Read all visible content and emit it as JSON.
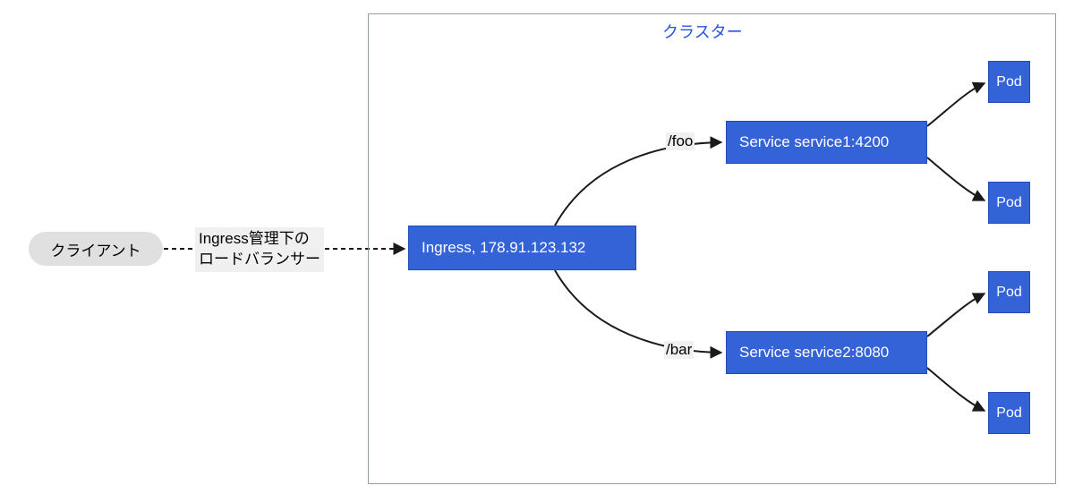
{
  "client_label": "クライアント",
  "lb_label_line1": "Ingress管理下の",
  "lb_label_line2": "ロードバランサー",
  "cluster_title": "クラスター",
  "ingress_label": "Ingress, 178.91.123.132",
  "service1_label": "Service service1:4200",
  "service2_label": "Service service2:8080",
  "route_foo": "/foo",
  "route_bar": "/bar",
  "pod_label": "Pod",
  "colors": {
    "node_bg": "#3463d8",
    "cluster_title": "#2454e6",
    "client_bg": "#e0e0e0"
  },
  "chart_data": {
    "type": "diagram",
    "title": "クラスター",
    "nodes": [
      {
        "id": "client",
        "label": "クライアント",
        "shape": "rounded"
      },
      {
        "id": "ingress",
        "label": "Ingress, 178.91.123.132",
        "shape": "rect"
      },
      {
        "id": "service1",
        "label": "Service service1:4200",
        "shape": "rect"
      },
      {
        "id": "service2",
        "label": "Service service2:8080",
        "shape": "rect"
      },
      {
        "id": "pod1",
        "label": "Pod",
        "shape": "rect"
      },
      {
        "id": "pod2",
        "label": "Pod",
        "shape": "rect"
      },
      {
        "id": "pod3",
        "label": "Pod",
        "shape": "rect"
      },
      {
        "id": "pod4",
        "label": "Pod",
        "shape": "rect"
      }
    ],
    "edges": [
      {
        "from": "client",
        "to": "ingress",
        "label": "Ingress管理下のロードバランサー",
        "style": "dashed"
      },
      {
        "from": "ingress",
        "to": "service1",
        "label": "/foo",
        "style": "solid"
      },
      {
        "from": "ingress",
        "to": "service2",
        "label": "/bar",
        "style": "solid"
      },
      {
        "from": "service1",
        "to": "pod1",
        "style": "solid"
      },
      {
        "from": "service1",
        "to": "pod2",
        "style": "solid"
      },
      {
        "from": "service2",
        "to": "pod3",
        "style": "solid"
      },
      {
        "from": "service2",
        "to": "pod4",
        "style": "solid"
      }
    ],
    "groups": [
      {
        "id": "cluster",
        "label": "クラスター",
        "members": [
          "ingress",
          "service1",
          "service2",
          "pod1",
          "pod2",
          "pod3",
          "pod4"
        ]
      }
    ]
  }
}
